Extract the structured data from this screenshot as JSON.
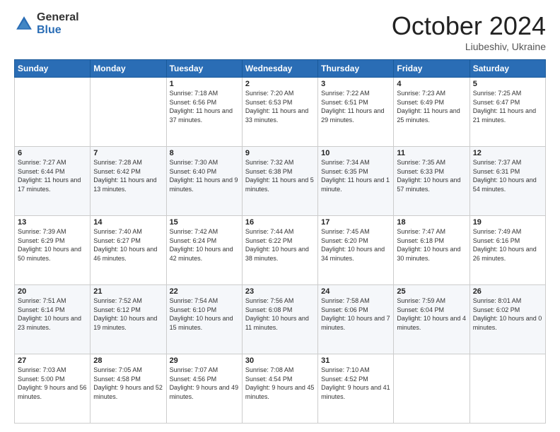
{
  "header": {
    "logo_general": "General",
    "logo_blue": "Blue",
    "month_title": "October 2024",
    "location": "Liubeshiv, Ukraine"
  },
  "days_of_week": [
    "Sunday",
    "Monday",
    "Tuesday",
    "Wednesday",
    "Thursday",
    "Friday",
    "Saturday"
  ],
  "weeks": [
    [
      {
        "day": "",
        "sunrise": "",
        "sunset": "",
        "daylight": ""
      },
      {
        "day": "",
        "sunrise": "",
        "sunset": "",
        "daylight": ""
      },
      {
        "day": "1",
        "sunrise": "Sunrise: 7:18 AM",
        "sunset": "Sunset: 6:56 PM",
        "daylight": "Daylight: 11 hours and 37 minutes."
      },
      {
        "day": "2",
        "sunrise": "Sunrise: 7:20 AM",
        "sunset": "Sunset: 6:53 PM",
        "daylight": "Daylight: 11 hours and 33 minutes."
      },
      {
        "day": "3",
        "sunrise": "Sunrise: 7:22 AM",
        "sunset": "Sunset: 6:51 PM",
        "daylight": "Daylight: 11 hours and 29 minutes."
      },
      {
        "day": "4",
        "sunrise": "Sunrise: 7:23 AM",
        "sunset": "Sunset: 6:49 PM",
        "daylight": "Daylight: 11 hours and 25 minutes."
      },
      {
        "day": "5",
        "sunrise": "Sunrise: 7:25 AM",
        "sunset": "Sunset: 6:47 PM",
        "daylight": "Daylight: 11 hours and 21 minutes."
      }
    ],
    [
      {
        "day": "6",
        "sunrise": "Sunrise: 7:27 AM",
        "sunset": "Sunset: 6:44 PM",
        "daylight": "Daylight: 11 hours and 17 minutes."
      },
      {
        "day": "7",
        "sunrise": "Sunrise: 7:28 AM",
        "sunset": "Sunset: 6:42 PM",
        "daylight": "Daylight: 11 hours and 13 minutes."
      },
      {
        "day": "8",
        "sunrise": "Sunrise: 7:30 AM",
        "sunset": "Sunset: 6:40 PM",
        "daylight": "Daylight: 11 hours and 9 minutes."
      },
      {
        "day": "9",
        "sunrise": "Sunrise: 7:32 AM",
        "sunset": "Sunset: 6:38 PM",
        "daylight": "Daylight: 11 hours and 5 minutes."
      },
      {
        "day": "10",
        "sunrise": "Sunrise: 7:34 AM",
        "sunset": "Sunset: 6:35 PM",
        "daylight": "Daylight: 11 hours and 1 minute."
      },
      {
        "day": "11",
        "sunrise": "Sunrise: 7:35 AM",
        "sunset": "Sunset: 6:33 PM",
        "daylight": "Daylight: 10 hours and 57 minutes."
      },
      {
        "day": "12",
        "sunrise": "Sunrise: 7:37 AM",
        "sunset": "Sunset: 6:31 PM",
        "daylight": "Daylight: 10 hours and 54 minutes."
      }
    ],
    [
      {
        "day": "13",
        "sunrise": "Sunrise: 7:39 AM",
        "sunset": "Sunset: 6:29 PM",
        "daylight": "Daylight: 10 hours and 50 minutes."
      },
      {
        "day": "14",
        "sunrise": "Sunrise: 7:40 AM",
        "sunset": "Sunset: 6:27 PM",
        "daylight": "Daylight: 10 hours and 46 minutes."
      },
      {
        "day": "15",
        "sunrise": "Sunrise: 7:42 AM",
        "sunset": "Sunset: 6:24 PM",
        "daylight": "Daylight: 10 hours and 42 minutes."
      },
      {
        "day": "16",
        "sunrise": "Sunrise: 7:44 AM",
        "sunset": "Sunset: 6:22 PM",
        "daylight": "Daylight: 10 hours and 38 minutes."
      },
      {
        "day": "17",
        "sunrise": "Sunrise: 7:45 AM",
        "sunset": "Sunset: 6:20 PM",
        "daylight": "Daylight: 10 hours and 34 minutes."
      },
      {
        "day": "18",
        "sunrise": "Sunrise: 7:47 AM",
        "sunset": "Sunset: 6:18 PM",
        "daylight": "Daylight: 10 hours and 30 minutes."
      },
      {
        "day": "19",
        "sunrise": "Sunrise: 7:49 AM",
        "sunset": "Sunset: 6:16 PM",
        "daylight": "Daylight: 10 hours and 26 minutes."
      }
    ],
    [
      {
        "day": "20",
        "sunrise": "Sunrise: 7:51 AM",
        "sunset": "Sunset: 6:14 PM",
        "daylight": "Daylight: 10 hours and 23 minutes."
      },
      {
        "day": "21",
        "sunrise": "Sunrise: 7:52 AM",
        "sunset": "Sunset: 6:12 PM",
        "daylight": "Daylight: 10 hours and 19 minutes."
      },
      {
        "day": "22",
        "sunrise": "Sunrise: 7:54 AM",
        "sunset": "Sunset: 6:10 PM",
        "daylight": "Daylight: 10 hours and 15 minutes."
      },
      {
        "day": "23",
        "sunrise": "Sunrise: 7:56 AM",
        "sunset": "Sunset: 6:08 PM",
        "daylight": "Daylight: 10 hours and 11 minutes."
      },
      {
        "day": "24",
        "sunrise": "Sunrise: 7:58 AM",
        "sunset": "Sunset: 6:06 PM",
        "daylight": "Daylight: 10 hours and 7 minutes."
      },
      {
        "day": "25",
        "sunrise": "Sunrise: 7:59 AM",
        "sunset": "Sunset: 6:04 PM",
        "daylight": "Daylight: 10 hours and 4 minutes."
      },
      {
        "day": "26",
        "sunrise": "Sunrise: 8:01 AM",
        "sunset": "Sunset: 6:02 PM",
        "daylight": "Daylight: 10 hours and 0 minutes."
      }
    ],
    [
      {
        "day": "27",
        "sunrise": "Sunrise: 7:03 AM",
        "sunset": "Sunset: 5:00 PM",
        "daylight": "Daylight: 9 hours and 56 minutes."
      },
      {
        "day": "28",
        "sunrise": "Sunrise: 7:05 AM",
        "sunset": "Sunset: 4:58 PM",
        "daylight": "Daylight: 9 hours and 52 minutes."
      },
      {
        "day": "29",
        "sunrise": "Sunrise: 7:07 AM",
        "sunset": "Sunset: 4:56 PM",
        "daylight": "Daylight: 9 hours and 49 minutes."
      },
      {
        "day": "30",
        "sunrise": "Sunrise: 7:08 AM",
        "sunset": "Sunset: 4:54 PM",
        "daylight": "Daylight: 9 hours and 45 minutes."
      },
      {
        "day": "31",
        "sunrise": "Sunrise: 7:10 AM",
        "sunset": "Sunset: 4:52 PM",
        "daylight": "Daylight: 9 hours and 41 minutes."
      },
      {
        "day": "",
        "sunrise": "",
        "sunset": "",
        "daylight": ""
      },
      {
        "day": "",
        "sunrise": "",
        "sunset": "",
        "daylight": ""
      }
    ]
  ]
}
